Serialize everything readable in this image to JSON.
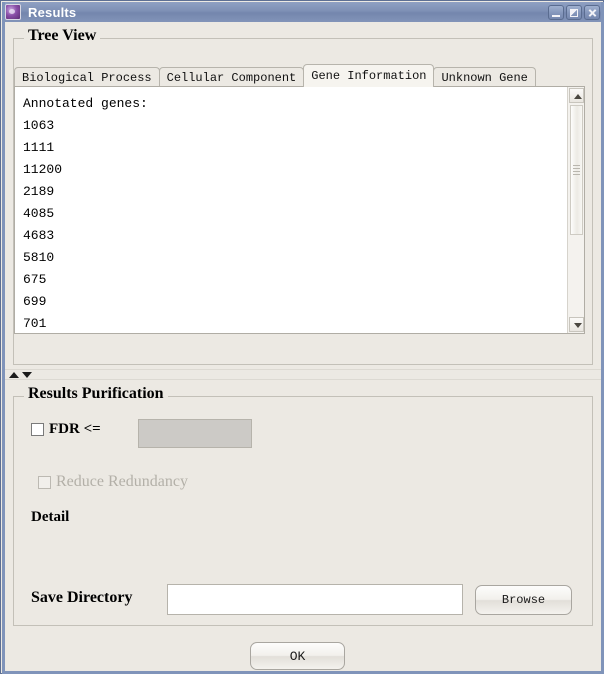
{
  "window": {
    "title": "Results",
    "icon": "app-icon",
    "buttons": {
      "minimize": "minimize-icon",
      "maximize": "maximize-icon",
      "close": "close-icon"
    }
  },
  "tree_view": {
    "title": "Tree View",
    "tabs": [
      {
        "label": "Biological Process",
        "selected": false
      },
      {
        "label": "Cellular Component",
        "selected": false
      },
      {
        "label": "Gene Information",
        "selected": true
      },
      {
        "label": "Unknown Gene",
        "selected": false
      }
    ],
    "content": {
      "heading": "Annotated genes:",
      "genes": [
        "1063",
        "1111",
        "11200",
        "2189",
        "4085",
        "4683",
        "5810",
        "675",
        "699",
        "701"
      ],
      "text": "Annotated genes:\n1063\n1111\n11200\n2189\n4085\n4683\n5810\n675\n699\n701"
    },
    "scrollbar": {
      "up_arrow": "scroll-up-icon",
      "down_arrow": "scroll-down-icon"
    }
  },
  "splitter": {
    "up_arrow": "split-expand-up-icon",
    "down_arrow": "split-expand-down-icon"
  },
  "purification": {
    "title": "Results Purification",
    "fdr": {
      "label": "FDR <=",
      "checked": false,
      "value": "",
      "enabled": false
    },
    "reduce_redundancy": {
      "label": "Reduce Redundancy",
      "checked": false,
      "enabled": false
    },
    "detail_label": "Detail",
    "save_directory": {
      "label": "Save Directory",
      "value": "",
      "browse_label": "Browse"
    }
  },
  "footer": {
    "ok_label": "OK"
  },
  "colors": {
    "titlebar_start": "#8fa0c3",
    "titlebar_end": "#8294b9",
    "frame_border": "#8094ba",
    "panel_background": "#ece9e3",
    "text_background": "#ffffff",
    "disabled_field": "#cccac6",
    "disabled_text": "#b3b0a8"
  }
}
